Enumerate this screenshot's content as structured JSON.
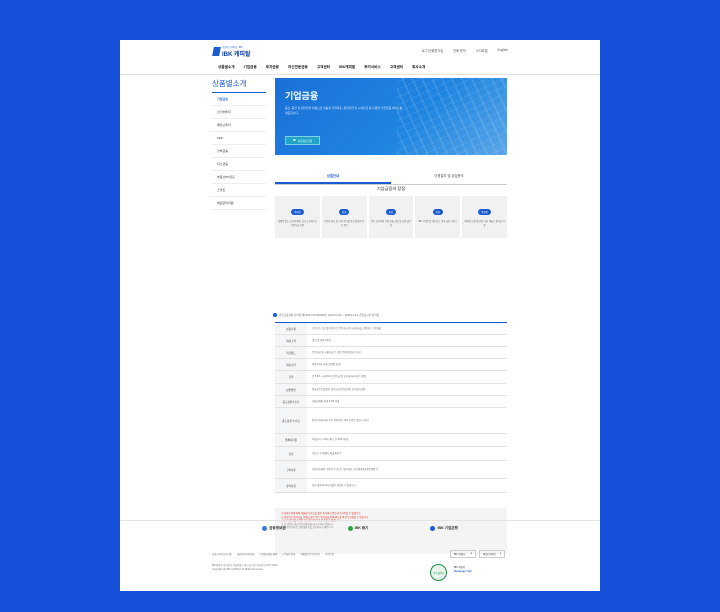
{
  "util": [
    "로그인/회원가입",
    "전화 문의",
    "사이트맵",
    "English"
  ],
  "logo": {
    "sub": "기업이 신뢰하는 IBK",
    "main": "IBK 캐피탈"
  },
  "gnb": [
    "상품별소개",
    "기업금융",
    "투자금융",
    "여신전문금융",
    "고객센터",
    "IBK캐피탈",
    "부가서비스",
    "고객센터",
    "회사소개"
  ],
  "lnb": {
    "title": "상품별소개",
    "items": [
      "기업금융",
      "신기술투자",
      "메자닌투자",
      "PEF",
      "할부금융",
      "리스금융",
      "부동산PF대출",
      "스마트",
      "채권관리지원"
    ]
  },
  "banner": {
    "title": "기업금융",
    "desc": "중소, 중견 및 대기업을 대상으로 맞춤형 기업대출, 운전자금 및 시설자금 등 다양한 기업금융 서비스를 제공합니다.",
    "button": "상품상담신청"
  },
  "tabs": [
    "상품안내",
    "이용절차 및 상담문의"
  ],
  "features": {
    "title": "기업금융의 장점",
    "items": [
      {
        "badge": "특장점",
        "text": "경쟁력 있는 금리와 빠른 심사 프로세스로 기업자금 지원"
      },
      {
        "badge": "장점",
        "text": "다양한 담보 및 신용 평가를 통한 맞춤형 한도 제공"
      },
      {
        "badge": "장점",
        "text": "전문 심사역의 기업 맞춤 상담 및 금융 솔루션"
      },
      {
        "badge": "장점",
        "text": "IBK 기업은행 네트워크 연계 금융 서비스"
      },
      {
        "badge": "특장점",
        "text": "비대면 신청 및 간편 서류 제출로 편리한 이용"
      }
    ]
  },
  "notice": "여신금융협회 심의필 제2024-L00-000000호 (2024.01.01 ~ 2025.12.31)  준법감시인 심의필",
  "info_rows": [
    {
      "th": "상품소개",
      "td": "신용 또는 담보를 바탕으로 운전자금 및 시설자금을 지원하는 기업대출"
    },
    {
      "th": "대상고객",
      "td": "법인 및 개인사업자"
    },
    {
      "th": "자금용도",
      "td": "운전자금 및 시설자금 등 사업 운영에 필요한 자금"
    },
    {
      "th": "대출기간",
      "td": "최장 10년 이내 (상품별 상이)"
    },
    {
      "th": "금리",
      "td": "연 5.0% ~ 12.0% (신용등급 및 담보에 따라 차등 적용)"
    },
    {
      "th": "상환방법",
      "td": "원금균등분할상환, 원리금균등분할상환, 만기일시상환"
    },
    {
      "th": "중도상환수수료",
      "td": "상환금액의 최대 2.0% 이내"
    },
    {
      "th": "중도상환 수수료",
      "td": "잔여기간에 따라 차등 적용되며, 세부 사항은 상담 시 안내"
    },
    {
      "th": "연체이자율",
      "td": "약정금리 + 3%p (최고 연 20% 이내)"
    },
    {
      "th": "담보",
      "td": "부동산, 기계설비, 매출채권 등"
    },
    {
      "th": "구비서류",
      "td": "사업자등록증, 법인등기부등본, 재무제표, 부가세과세표준증명원 등"
    },
    {
      "th": "유의사항",
      "td": "심사 결과에 따라 대출이 제한될 수 있습니다."
    }
  ],
  "warnings": {
    "red": [
      "※ 상환능력에 비해 대출금이 과도할 경우 귀사의 신용등급이 하락할 수 있습니다.",
      "※ 일정기간 원리금을 연체할 경우 모든 원리금을 변제해야 할 의무가 발생할 수 있습니다.",
      "※ 금리 및 대출조건은 심사 결과에 따라 달라질 수 있습니다."
    ],
    "gray": [
      "※ 본 상품은 예금자보호법에 따라 보호되지 않습니다.",
      "※ 자세한 내용은 상품설명서를 참조하시기 바랍니다."
    ]
  },
  "partners": [
    "금융정보원",
    "IBK 중기",
    "IBK 기업은행"
  ],
  "footer_links": [
    "금융소비자보호기준",
    "개인정보처리방침",
    "신용정보활용체제",
    "고객권리안내",
    "이메일무단수집거부",
    "사이트맵"
  ],
  "footer_selects": [
    "IBK 계열사",
    "패밀리사이트"
  ],
  "footer_address": [
    "IBK캐피탈 주식회사  서울특별시 중구 을지로  대표번호 1577-0000",
    "Copyright (C) IBK CAPITAL All Rights Reserved."
  ],
  "footer_badge": "우수 콜센터",
  "footer_synergy": {
    "label": "IBK 계열사",
    "main": "Synergy Up!"
  }
}
